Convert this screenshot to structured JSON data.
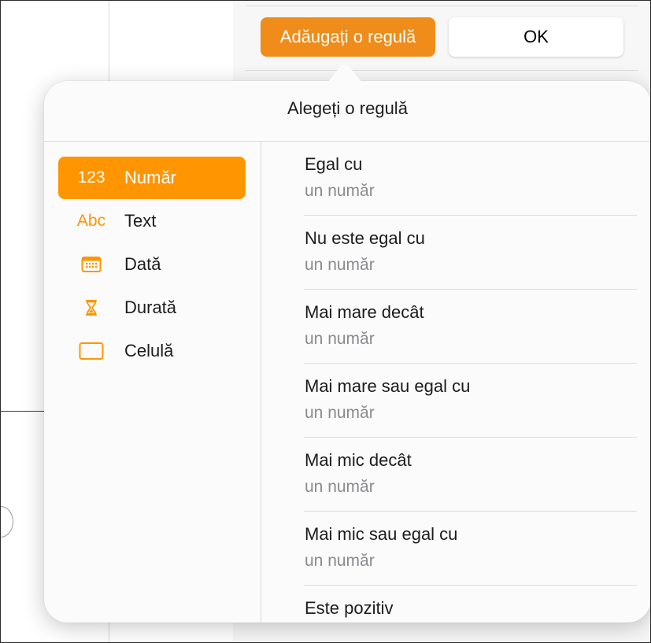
{
  "toolbar": {
    "add_rule_label": "Adăugați o regulă",
    "ok_label": "OK"
  },
  "popover": {
    "title": "Alegeți o regulă"
  },
  "categories": [
    {
      "icon_text": "123",
      "icon": "number-icon",
      "label": "Număr",
      "selected": true
    },
    {
      "icon_text": "Abc",
      "icon": "text-icon",
      "label": "Text",
      "selected": false
    },
    {
      "icon_text": "",
      "icon": "calendar-icon",
      "label": "Dată",
      "selected": false
    },
    {
      "icon_text": "",
      "icon": "hourglass-icon",
      "label": "Durată",
      "selected": false
    },
    {
      "icon_text": "",
      "icon": "cell-icon",
      "label": "Celulă",
      "selected": false
    }
  ],
  "rules": [
    {
      "title": "Egal cu",
      "subtitle": "un număr"
    },
    {
      "title": "Nu este egal cu",
      "subtitle": "un număr"
    },
    {
      "title": "Mai mare decât",
      "subtitle": "un număr"
    },
    {
      "title": "Mai mare sau egal cu",
      "subtitle": "un număr"
    },
    {
      "title": "Mai mic decât",
      "subtitle": "un număr"
    },
    {
      "title": "Mai mic sau egal cu",
      "subtitle": "un număr"
    },
    {
      "title": "Este pozitiv",
      "subtitle": ""
    }
  ],
  "colors": {
    "accent": "#ff9500",
    "button": "#ef8c1a"
  }
}
